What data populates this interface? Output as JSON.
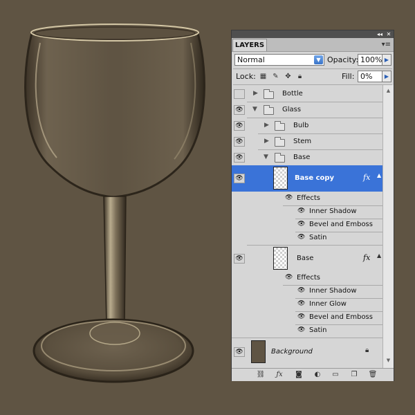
{
  "panel": {
    "tab": "LAYERS",
    "title_buttons": {
      "collapse": "◂◂",
      "close": "✕"
    },
    "blend_mode": "Normal",
    "opacity_label": "Opacity:",
    "opacity_value": "100%",
    "lock_label": "Lock:",
    "fill_label": "Fill:",
    "fill_value": "0%"
  },
  "layers": [
    {
      "name": "Bottle",
      "visible": false
    },
    {
      "name": "Glass",
      "visible": true
    },
    {
      "name": "Bulb",
      "visible": true
    },
    {
      "name": "Stem",
      "visible": true
    },
    {
      "name": "Base",
      "visible": true
    }
  ],
  "base_copy": {
    "name": "Base copy",
    "fx": "fx",
    "effects_label": "Effects",
    "effects": [
      "Inner Shadow",
      "Bevel and Emboss",
      "Satin"
    ]
  },
  "base_layer": {
    "name": "Base",
    "fx": "fx",
    "effects_label": "Effects",
    "effects": [
      "Inner Shadow",
      "Inner Glow",
      "Bevel and Emboss",
      "Satin"
    ]
  },
  "background_layer": {
    "name": "Background",
    "color": "#5f5443"
  },
  "colors": {
    "canvas": "#5f5443",
    "selection": "#3a73d8",
    "panel": "#d6d6d6"
  }
}
